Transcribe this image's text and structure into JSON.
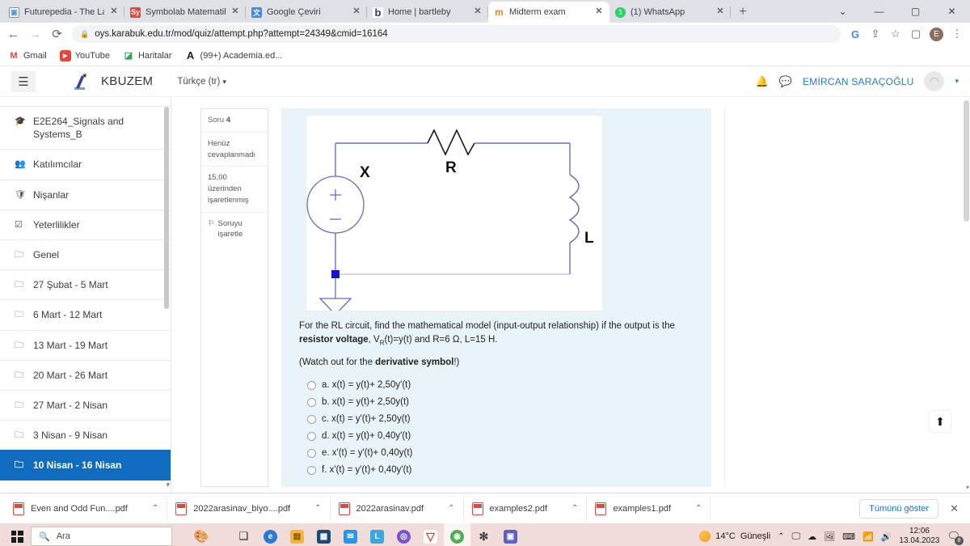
{
  "browser": {
    "tabs": [
      {
        "title": "Futurepedia - The Largest A",
        "icon": "window-icon",
        "active": false
      },
      {
        "title": "Symbolab Matematik Çözü",
        "icon": "symbolab-icon",
        "active": false
      },
      {
        "title": "Google Çeviri",
        "icon": "translate-icon",
        "active": false
      },
      {
        "title": "Home | bartleby",
        "icon": "bartleby-icon",
        "active": false
      },
      {
        "title": "Midterm exam",
        "icon": "moodle-icon",
        "active": true
      },
      {
        "title": "(1) WhatsApp",
        "icon": "whatsapp-icon",
        "active": false
      }
    ],
    "new_tab_label": "+",
    "window_controls": [
      "⌄",
      "—",
      "▢",
      "✕"
    ],
    "nav": {
      "back": "←",
      "forward": "→",
      "reload": "⟳"
    },
    "url": "oys.karabuk.edu.tr/mod/quiz/attempt.php?attempt=24349&cmid=16164",
    "lock_icon": "🔒",
    "toolbar_icons": [
      "google-icon",
      "share-icon",
      "star-icon",
      "side-panel-icon",
      "profile-icon",
      "chrome-menu-icon"
    ],
    "profile_initial": "E",
    "bookmarks": [
      {
        "label": "Gmail",
        "icon": "gmail-icon"
      },
      {
        "label": "YouTube",
        "icon": "youtube-icon"
      },
      {
        "label": "Haritalar",
        "icon": "maps-icon"
      },
      {
        "label": "(99+) Academia.ed...",
        "icon": "academia-icon"
      }
    ]
  },
  "moodle": {
    "menu_icon": "hamburger-icon",
    "brand": "KBUZEM",
    "language": "Türkçe (tr)",
    "language_caret": "▾",
    "notifications_icon": "bell-icon",
    "messages_icon": "message-icon",
    "user_name": "EMİRCAN SARAÇOĞLU",
    "user_caret": "▾"
  },
  "sidebar": {
    "items": [
      {
        "label": "E2E264_Signals and Systems_B",
        "icon": "graduation-cap-icon",
        "active": false
      },
      {
        "label": "Katılımcılar",
        "icon": "participants-icon",
        "active": false
      },
      {
        "label": "Nişanlar",
        "icon": "badge-icon",
        "active": false
      },
      {
        "label": "Yeterlilikler",
        "icon": "check-square-icon",
        "active": false
      },
      {
        "label": "Genel",
        "icon": "folder-icon",
        "active": false
      },
      {
        "label": "27 Şubat - 5 Mart",
        "icon": "folder-icon",
        "active": false
      },
      {
        "label": "6 Mart - 12 Mart",
        "icon": "folder-icon",
        "active": false
      },
      {
        "label": "13 Mart - 19 Mart",
        "icon": "folder-icon",
        "active": false
      },
      {
        "label": "20 Mart - 26 Mart",
        "icon": "folder-icon",
        "active": false
      },
      {
        "label": "27 Mart - 2 Nisan",
        "icon": "folder-icon",
        "active": false
      },
      {
        "label": "3 Nisan - 9 Nisan",
        "icon": "folder-icon",
        "active": false
      },
      {
        "label": "10 Nisan - 16 Nisan",
        "icon": "folder-icon",
        "active": true
      }
    ],
    "scroll_down_caret": "▾"
  },
  "question": {
    "number_label": "Soru",
    "number": "4",
    "state": "Henüz cevaplanmadı",
    "marks": "15,00 üzerinden işaretlenmiş",
    "flag_icon": "flag-icon",
    "flag_label": "Soruyu işaretle",
    "figure": {
      "source_label": "X",
      "resistor_label": "R",
      "inductor_label": "L"
    },
    "text_line1_a": "For the RL circuit, find the mathematical model (input-output relationship) if the output is the ",
    "text_line1_b": "resistor voltage",
    "text_line1_c": ", V",
    "text_line1_sub": "R",
    "text_line1_d": "(t)=y(t) and R=6 Ω, L=15 H.",
    "text_line2_a": "(Watch out for the ",
    "text_line2_b": "derivative symbol",
    "text_line2_c": "!)",
    "options": [
      "a. x(t) = y(t)+ 2,50y'(t)",
      "b. x(t) = y(t)+ 2,50y(t)",
      "c. x(t) = y'(t)+ 2,50y(t)",
      "d. x(t) = y(t)+ 0,40y'(t)",
      "e. x'(t) = y'(t)+ 0,40y(t)",
      "f. x'(t) = y'(t)+ 0,40y'(t)"
    ],
    "scroll_top_icon": "arrow-up-icon"
  },
  "downloads": {
    "items": [
      {
        "name": "Even and Odd Fun....pdf",
        "caret": "⌃"
      },
      {
        "name": "2022arasinav_biyo....pdf",
        "caret": "⌃"
      },
      {
        "name": "2022arasinav.pdf",
        "caret": "⌃"
      },
      {
        "name": "examples2.pdf",
        "caret": "⌃"
      },
      {
        "name": "examples1.pdf",
        "caret": "⌃"
      }
    ],
    "show_all": "Tümünü göster",
    "close": "✕"
  },
  "taskbar": {
    "start_icon": "windows-icon",
    "search_placeholder": "Ara",
    "search_icon": "search-icon",
    "task_view_icon": "task-view-icon",
    "apps": [
      {
        "name": "edge-icon",
        "color": "#2b7bd4",
        "glyph": "e"
      },
      {
        "name": "file-explorer-icon",
        "color": "#f5b63d",
        "glyph": ""
      },
      {
        "name": "microsoft-store-icon",
        "color": "#1b4a7a",
        "glyph": "▦"
      },
      {
        "name": "mail-icon",
        "color": "#2196f3",
        "glyph": "✉"
      },
      {
        "name": "l-app-icon",
        "color": "#3aa6dd",
        "glyph": "L"
      },
      {
        "name": "zoom-icon",
        "color": "#7b4fd6",
        "glyph": "◎"
      },
      {
        "name": "antivirus-icon",
        "color": "#e8453c",
        "glyph": "▽"
      },
      {
        "name": "chrome-icon",
        "color": "#4285f4",
        "glyph": "◉"
      },
      {
        "name": "settings-icon",
        "color": "#3c4043",
        "glyph": "✻"
      },
      {
        "name": "teams-icon",
        "color": "#5b5fc7",
        "glyph": "▣"
      }
    ],
    "weather_temp": "14°C",
    "weather_desc": "Güneşli",
    "tray_caret": "⌃",
    "tray_icons": [
      "screen-icon",
      "cloud-icon",
      "display-icon",
      "keyboard-icon",
      "wifi-icon",
      "volume-icon"
    ],
    "time": "12:06",
    "date": "13.04.2023",
    "notification_count": "8"
  }
}
